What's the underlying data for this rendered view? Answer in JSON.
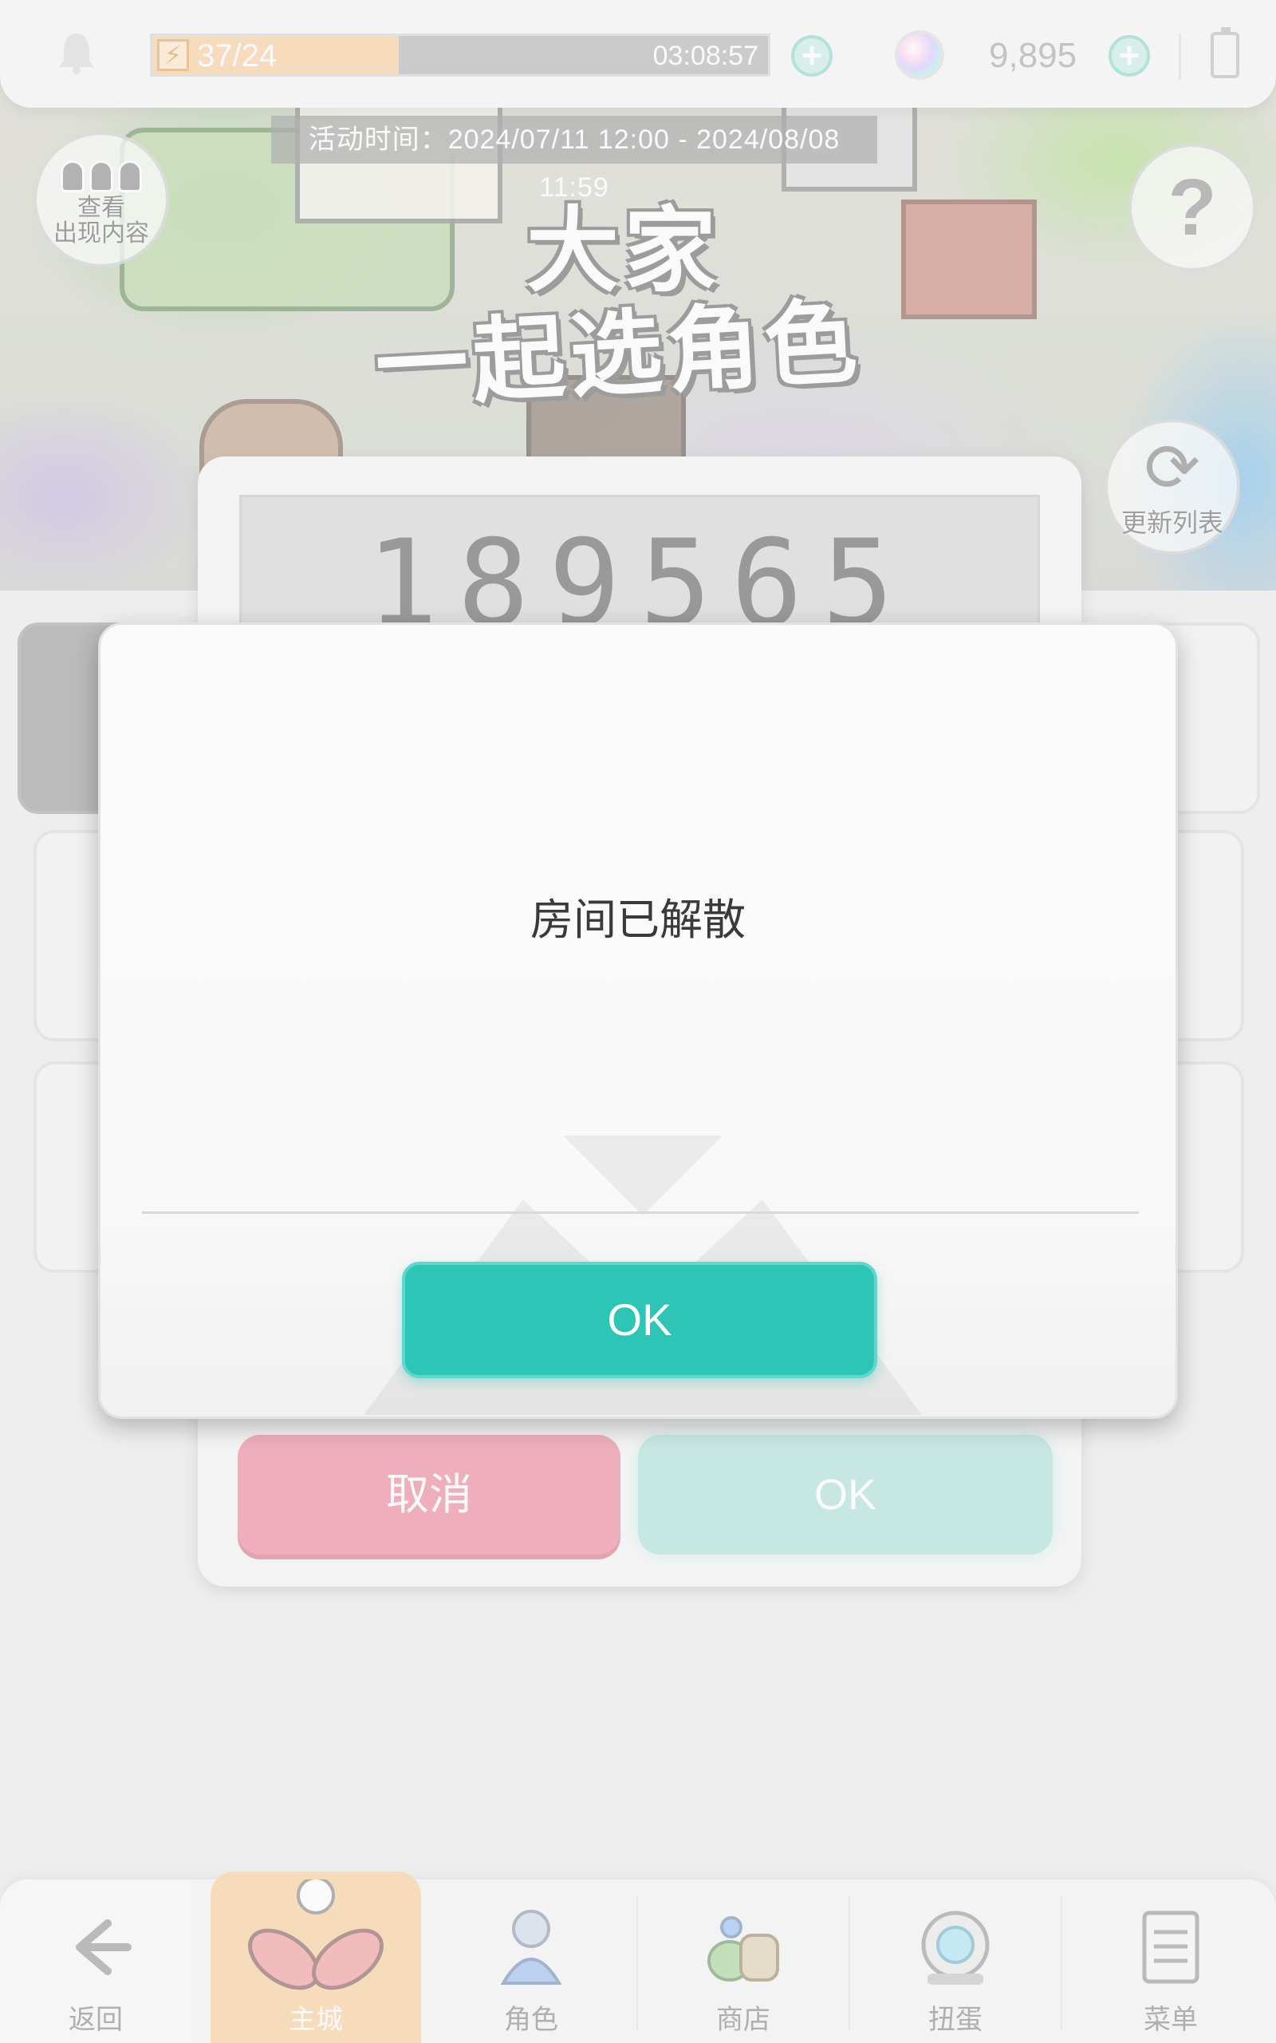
{
  "status_bar": {
    "stamina_text": "37/24",
    "stamina_timer": "03:08:57",
    "stamina_fraction": 0.4,
    "gem_count": "9,895",
    "icons": {
      "notification": "bell-icon",
      "stamina": "lightning-icon",
      "add": "plus-icon",
      "gem": "gem-icon",
      "battery": "battery-icon"
    }
  },
  "event": {
    "period": "活动时间：2024/07/11 12:00 - 2024/08/08 11:59",
    "title_line1": "大家",
    "title_line2": "一起选角色"
  },
  "scene_buttons": {
    "view_content": "查看\n出现内容",
    "help": "?",
    "refresh": "更新列表"
  },
  "room": {
    "code": "189565",
    "cancel_label": "取消",
    "ok_label": "OK"
  },
  "dialog": {
    "message": "房间已解散",
    "ok_label": "OK"
  },
  "bottom_nav": {
    "back": "返回",
    "main": "主城",
    "characters": "角色",
    "shop": "商店",
    "gacha": "扭蛋",
    "menu": "菜单"
  },
  "colors": {
    "accent_teal": "#2cc5b6",
    "cancel_pink": "#e9758c",
    "stamina_orange": "#f7c791",
    "nav_active": "#f9c98e"
  }
}
